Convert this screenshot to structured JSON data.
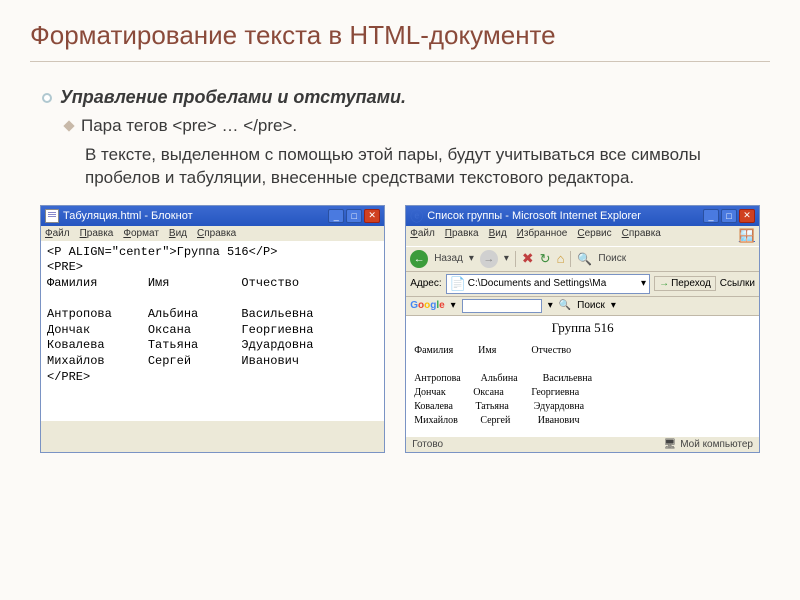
{
  "page": {
    "title": "Форматирование текста в HTML-документе",
    "subtitle": "Управление пробелами и отступами.",
    "tags_line": "Пара тегов <pre> … </pre>.",
    "body": "В тексте, выделенном с помощью этой пары, будут учитываться все символы пробелов и табуляции,  внесенные средствами текстового редактора."
  },
  "notepad": {
    "title": "Табуляция.html - Блокнот",
    "menu": [
      "Файл",
      "Правка",
      "Формат",
      "Вид",
      "Справка"
    ],
    "content": "<P ALIGN=\"center\">Группа 516</P>\n<PRE>\nФамилия       Имя          Отчество\n\nАнтропова     Альбина      Васильевна\nДончак        Оксана       Георгиевна\nКовалева      Татьяна      Эдуардовна\nМихайлов      Сергей       Иванович\n</PRE>"
  },
  "ie": {
    "title": "Список группы - Microsoft Internet Explorer",
    "menu": [
      "Файл",
      "Правка",
      "Вид",
      "Избранное",
      "Сервис",
      "Справка"
    ],
    "toolbar": {
      "back": "Назад",
      "search": "Поиск"
    },
    "address": {
      "label": "Адрес:",
      "value": "C:\\Documents and Settings\\Ма",
      "go": "Переход",
      "links": "Ссылки"
    },
    "google": {
      "label": "Google",
      "search": "Поиск"
    },
    "content": {
      "heading": "Группа 516",
      "table": "Фамилия          Имя              Отчество\n\nАнтропова        Альбина          Васильевна\nДончак           Оксана           Георгиевна\nКовалева         Татьяна          Эдуардовна\nМихайлов         Сергей           Иванович"
    },
    "status": {
      "left": "Готово",
      "right": "Мой компьютер"
    }
  }
}
